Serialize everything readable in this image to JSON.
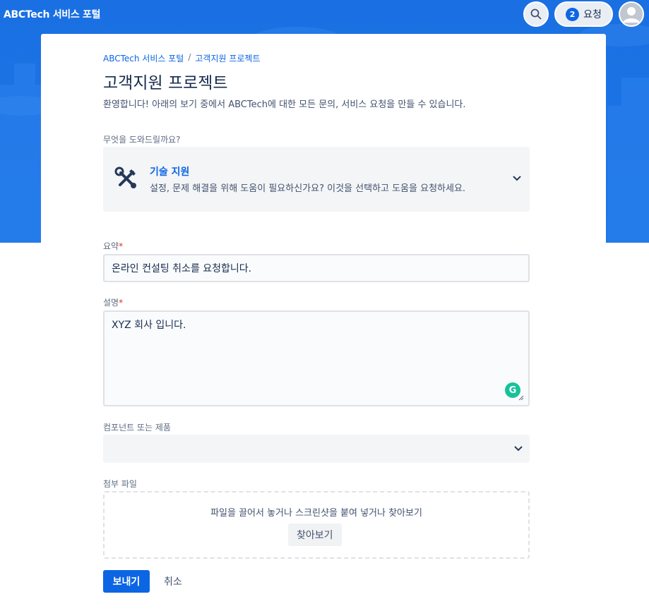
{
  "header": {
    "brand": "ABCTech 서비스 포털",
    "requests_count": "2",
    "requests_label": "요청"
  },
  "breadcrumb": {
    "items": [
      "ABCTech 서비스 포털",
      "고객지원 프로젝트"
    ],
    "separator": "/"
  },
  "page": {
    "title": "고객지원 프로젝트",
    "welcome": "환영합니다! 아래의 보기 중에서 ABCTech에 대한 모든 문의, 서비스 요청을 만들 수 있습니다."
  },
  "request_type": {
    "label": "무엇을 도와드릴까요?",
    "name": "기술 지원",
    "description": "설정, 문제 해결을 위해 도움이 필요하신가요? 이것을 선택하고 도움을 요청하세요."
  },
  "form": {
    "summary_label": "요약",
    "summary_value": "온라인 컨설팅 취소를 요청합니다.",
    "description_label": "설명",
    "description_value": "XYZ 회사 입니다.",
    "component_label": "컴포넌트 또는 제품",
    "component_value": "",
    "attachment_label": "첨부 파일",
    "dropzone_text": "파일을 끌어서 놓거나 스크린샷을 붙여 넣거나 찾아보기",
    "browse_label": "찾아보기",
    "required_mark": "*"
  },
  "actions": {
    "send_label": "보내기",
    "cancel_label": "취소"
  },
  "colors": {
    "header_bg": "#1a70e2",
    "accent": "#0c66e4",
    "required": "#de350b",
    "grammarly": "#15c39a"
  },
  "icons": [
    "search-icon",
    "avatar-icon",
    "tools-icon",
    "chevron-down-icon",
    "grammarly-icon",
    "resize-handle-icon"
  ]
}
